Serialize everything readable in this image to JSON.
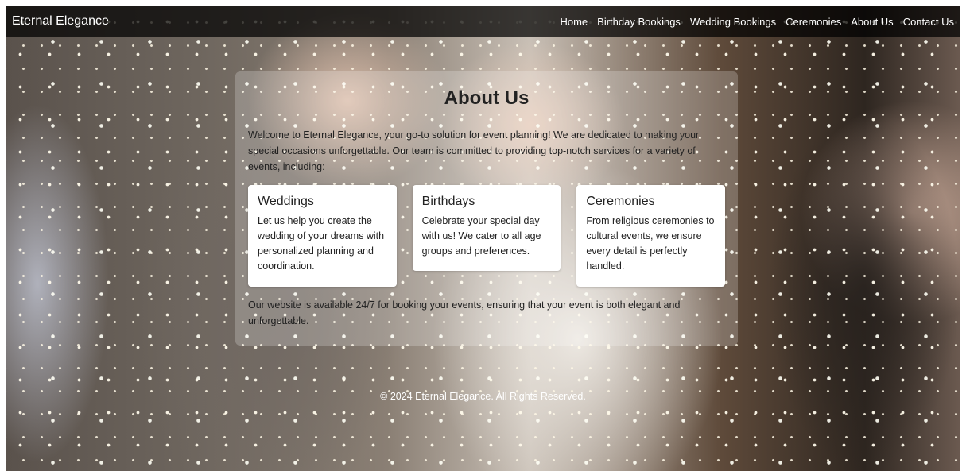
{
  "navbar": {
    "brand": "Eternal Elegance",
    "links": [
      "Home",
      "Birthday Bookings",
      "Wedding Bookings",
      "Ceremonies",
      "About Us",
      "Contact Us"
    ]
  },
  "about": {
    "title": "About Us",
    "intro": "Welcome to Eternal Elegance, your go-to solution for event planning! We are dedicated to making your special occasions unforgettable. Our team is committed to providing top-notch services for a variety of events, including:",
    "cards": [
      {
        "title": "Weddings",
        "text": "Let us help you create the wedding of your dreams with personalized planning and coordination."
      },
      {
        "title": "Birthdays",
        "text": "Celebrate your special day with us! We cater to all age groups and preferences."
      },
      {
        "title": "Ceremonies",
        "text": "From religious ceremonies to cultural events, we ensure every detail is perfectly handled."
      }
    ],
    "outro": "Our website is available 24/7 for booking your events, ensuring that your event is both elegant and unforgettable."
  },
  "footer": {
    "text": "© 2024 Eternal Elegance. All Rights Reserved."
  }
}
